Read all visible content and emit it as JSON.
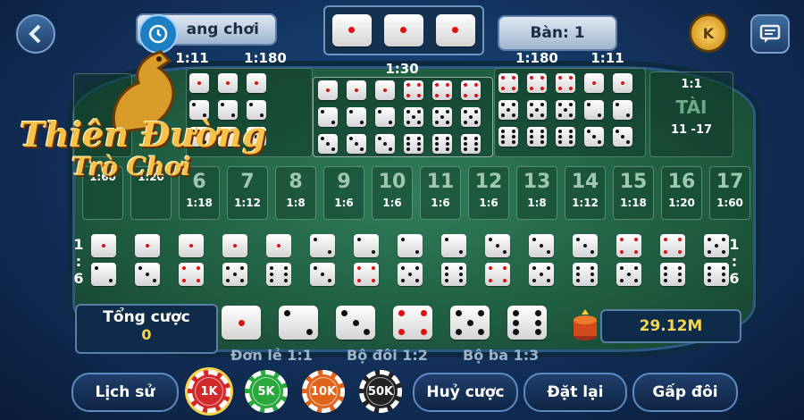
{
  "header": {
    "history_label": "ang chơi",
    "table_label": "Bàn: 1",
    "back_icon": "chevron-left-icon",
    "coin_icon": "k-coin-icon",
    "chat_icon": "chat-icon"
  },
  "top_ratios": {
    "left_pair": "1:11",
    "left_triple": "1:180",
    "any_triple": "1:30",
    "right_triple": "1:180",
    "right_pair": "1:11"
  },
  "tai": {
    "ratio": "1:1",
    "label": "TÀI",
    "range": "11 -17"
  },
  "logo": {
    "line1": "Thiên Đường",
    "line2": "Trò Chơi"
  },
  "sums": [
    {
      "n": "",
      "p": "1:60"
    },
    {
      "n": "",
      "p": "1:20"
    },
    {
      "n": "6",
      "p": "1:18"
    },
    {
      "n": "7",
      "p": "1:12"
    },
    {
      "n": "8",
      "p": "1:8"
    },
    {
      "n": "9",
      "p": "1:6"
    },
    {
      "n": "10",
      "p": "1:6"
    },
    {
      "n": "11",
      "p": "1:6"
    },
    {
      "n": "12",
      "p": "1:6"
    },
    {
      "n": "13",
      "p": "1:8"
    },
    {
      "n": "14",
      "p": "1:12"
    },
    {
      "n": "15",
      "p": "1:18"
    },
    {
      "n": "16",
      "p": "1:20"
    },
    {
      "n": "17",
      "p": "1:60"
    }
  ],
  "combo_side": {
    "left": [
      "1",
      ":",
      "6"
    ],
    "right": [
      "1",
      ":",
      "6"
    ]
  },
  "combos": [
    [
      1,
      2
    ],
    [
      1,
      3
    ],
    [
      1,
      4
    ],
    [
      1,
      5
    ],
    [
      1,
      6
    ],
    [
      2,
      3
    ],
    [
      2,
      4
    ],
    [
      2,
      5
    ],
    [
      2,
      6
    ],
    [
      3,
      4
    ],
    [
      3,
      5
    ],
    [
      3,
      6
    ],
    [
      4,
      5
    ],
    [
      4,
      6
    ],
    [
      5,
      6
    ]
  ],
  "singles": [
    1,
    2,
    3,
    4,
    5,
    6
  ],
  "total_bet": {
    "label": "Tổng cược",
    "value": "0"
  },
  "balance": "29.12M",
  "bet_types": {
    "single": "Đơn lẻ 1:1",
    "double": "Bộ đôi 1:2",
    "triple": "Bộ ba 1:3"
  },
  "buttons": {
    "history": "Lịch sử",
    "cancel": "Huỷ cược",
    "reset": "Đặt lại",
    "double": "Gấp đôi"
  },
  "chips": [
    {
      "label": "1K",
      "color": "#d22a2a"
    },
    {
      "label": "5K",
      "color": "#29a83c"
    },
    {
      "label": "10K",
      "color": "#e0641c"
    },
    {
      "label": "50K",
      "color": "#222222"
    }
  ]
}
